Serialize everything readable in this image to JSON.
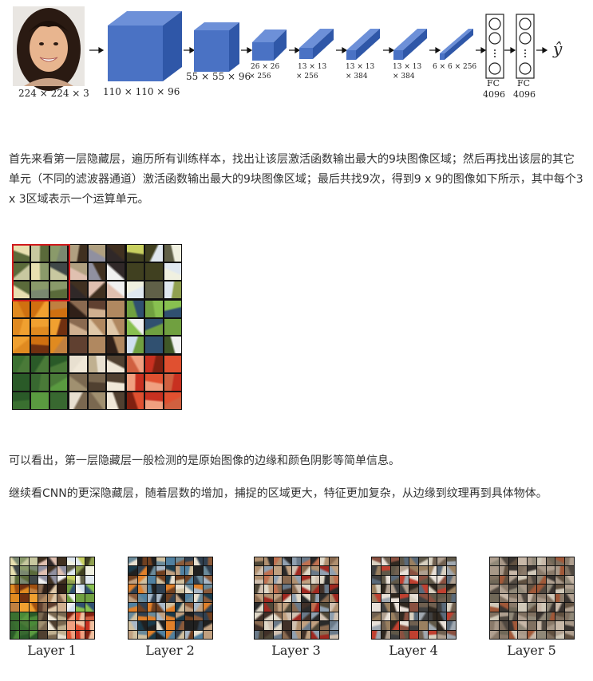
{
  "network": {
    "input_label": "224 × 224 × 3",
    "layer1_label": "110 × 110 × 96",
    "layer2_label": "55 × 55 × 96",
    "layer3_label": [
      "26 × 26",
      "× 256"
    ],
    "layer4_label": [
      "13 × 13",
      "× 256"
    ],
    "layer5_label": [
      "13 × 13",
      "× 384"
    ],
    "layer6_label": [
      "13 × 13",
      "× 384"
    ],
    "layer7_label": "6 × 6 × 256",
    "fc1_label": [
      "FC",
      "4096"
    ],
    "fc2_label": [
      "FC",
      "4096"
    ],
    "output_label": "ŷ"
  },
  "text": {
    "p1": "首先来看第一层隐藏层，遍历所有训练样本，找出让该层激活函数输出最大的9块图像区域；然后再找出该层的其它单元（不同的滤波器通道）激活函数输出最大的9块图像区域；最后共找9次，得到9 x 9的图像如下所示，其中每个3 x 3区域表示一个运算单元。",
    "p2": "可以看出，第一层隐藏层一般检测的是原始图像的边缘和颜色阴影等简单信息。",
    "p3": "继续看CNN的更深隐藏层，随着层数的增加，捕捉的区域更大，特征更加复杂，从边缘到纹理再到具体物体。"
  },
  "layers": [
    "Layer 1",
    "Layer 2",
    "Layer 3",
    "Layer 4",
    "Layer 5"
  ],
  "colors": {
    "block_front": "#4a72c4",
    "block_top": "#6d90d8",
    "block_side": "#2f57a8",
    "highlight": "#d0191c"
  }
}
